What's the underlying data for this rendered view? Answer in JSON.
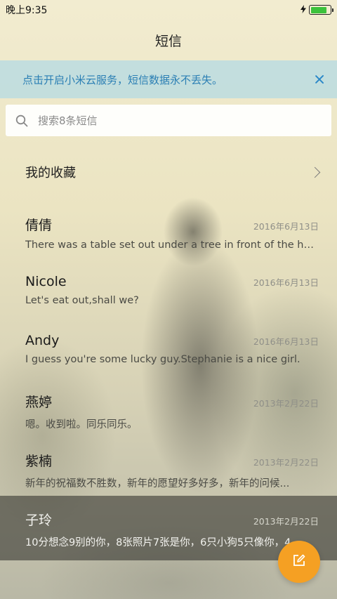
{
  "status_bar": {
    "time": "晚上9:35",
    "battery_percent": 85,
    "battery_color": "#3cc23c",
    "charging_icon": "bolt-icon"
  },
  "header": {
    "title": "短信"
  },
  "notice": {
    "text": "点击开启小米云服务，短信数据永不丢失。",
    "close_icon": "close-icon",
    "color": "#2b7fb4"
  },
  "search": {
    "placeholder": "搜索8条短信",
    "value": ""
  },
  "favorites": {
    "label": "我的收藏"
  },
  "conversations": [
    {
      "name": "倩倩",
      "date": "2016年6月13日",
      "preview": "There was a table set out under a tree in front of the ho..."
    },
    {
      "name": "Nicole",
      "date": "2016年6月13日",
      "preview": "Let's eat out,shall we?"
    },
    {
      "name": "Andy",
      "date": "2016年6月13日",
      "preview": "I guess you're some lucky guy.Stephanie is a nice girl."
    },
    {
      "name": "燕婷",
      "date": "2013年2月22日",
      "preview": "嗯。收到啦。同乐同乐。"
    },
    {
      "name": "紫楠",
      "date": "2013年2月22日",
      "preview": "新年的祝福数不胜数，新年的愿望好多好多，新年的问候..."
    },
    {
      "name": "子玲",
      "date": "2013年2月22日",
      "preview": "10分想念9别的你，8张照片7张是你，6只小狗5只像你，4..."
    }
  ],
  "compose_button": {
    "icon": "compose-icon",
    "color": "#f5a023"
  }
}
